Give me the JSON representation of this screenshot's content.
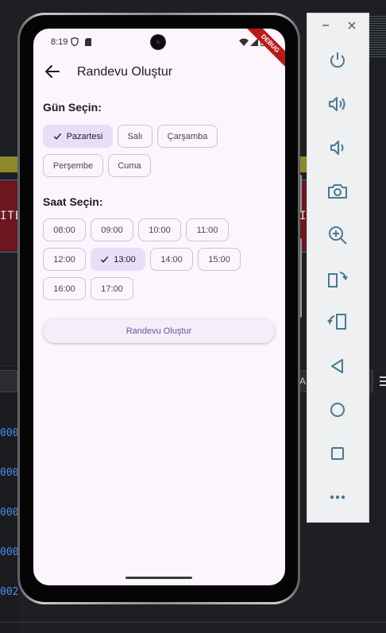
{
  "status_bar": {
    "time": "8:19",
    "debug_banner": "DEBUG"
  },
  "app_bar": {
    "title": "Randevu Oluştur",
    "back_icon": "arrow-back-icon"
  },
  "day_section": {
    "title": "Gün Seçin:",
    "selected": "Pazartesi",
    "days": [
      "Pazartesi",
      "Salı",
      "Çarşamba",
      "Perşembe",
      "Cuma"
    ]
  },
  "time_section": {
    "title": "Saat Seçin:",
    "selected": "13:00",
    "times": [
      "08:00",
      "09:00",
      "10:00",
      "11:00",
      "12:00",
      "13:00",
      "14:00",
      "15:00",
      "16:00",
      "17:00"
    ]
  },
  "submit_button": {
    "label": "Randevu Oluştur"
  },
  "background": {
    "left_code_fragment": "ITE",
    "right_code_fragment": "I",
    "code_lines": [
      "000",
      "000",
      "000",
      "000",
      "002"
    ],
    "search_field_text": "A"
  },
  "emulator_toolbar": {
    "icons": [
      "minimize-icon",
      "close-icon",
      "power-icon",
      "volume-up-icon",
      "volume-down-icon",
      "camera-icon",
      "zoom-icon",
      "rotate-left-icon",
      "rotate-right-icon",
      "back-triangle-icon",
      "home-circle-icon",
      "overview-square-icon",
      "more-icon"
    ]
  },
  "colors": {
    "screen_bg": "#fcf5fe",
    "chip_selected_bg": "#e8def8",
    "accent": "#6750a4",
    "toolbar_bg": "#eef0f2",
    "toolbar_icon": "#4a7890"
  }
}
